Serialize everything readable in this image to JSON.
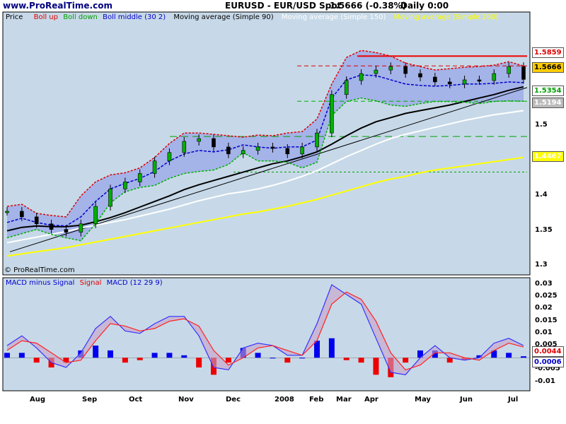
{
  "header": {
    "site": "www.ProRealTime.com",
    "symbol": "EURUSD - EUR/USD Spot",
    "price_change": "1.5666 (-0.38%)",
    "period": "Daily 0:00"
  },
  "watermark": "© ProRealTime.com",
  "colors": {
    "panel_bg": "#c7d9e8",
    "band_fill": "#a0aee8",
    "boll_up": "#dd0000",
    "boll_down": "#00b000",
    "boll_middle": "#0000cc",
    "ma90": "#000000",
    "ma150": "#ffffff",
    "ma200": "#ffff00",
    "resistance": "#ee0000",
    "macd": "#3333ff",
    "signal": "#ff2222"
  },
  "price_legend": {
    "price": "Price",
    "boll_up": "Boll up",
    "boll_down": "Boll down",
    "boll_middle": "Boll middle (30 2)",
    "ma90": "Moving average (Simple 90)",
    "ma150": "Moving average (Simple 150)",
    "ma200": "Moving average (Simple 200)"
  },
  "macd_legend": {
    "histogram": "MACD minus Signal",
    "signal": "Signal",
    "macd": "MACD (12 29 9)"
  },
  "price_badges": {
    "boll_up": "1.5859",
    "last": "1.5666",
    "boll_down": "1.5354",
    "ma150": "1.5194",
    "ma200": "1.4467"
  },
  "macd_badges": {
    "signal": "0.0044",
    "histogram": "0.0006"
  },
  "chart_data": [
    {
      "type": "candlestick",
      "title": "EURUSD - EUR/USD Spot",
      "ylim": [
        1.29,
        1.66
      ],
      "y_ticks": [
        "1.6",
        "1.55",
        "1.5",
        "1.45",
        "1.4",
        "1.35",
        "1.3"
      ],
      "x_labels": [
        "Aug",
        "Sep",
        "Oct",
        "Nov",
        "Dec",
        "2008",
        "Feb",
        "Mar",
        "Apr",
        "May",
        "Jun",
        "Jul"
      ],
      "series": [
        {
          "name": "Price",
          "x": [
            0,
            10,
            20,
            30,
            40,
            50,
            60,
            70,
            80,
            90,
            100,
            110,
            120,
            130,
            140,
            150,
            160,
            170,
            180,
            190,
            200,
            210,
            220,
            230,
            240,
            250,
            260,
            270,
            280,
            290,
            300,
            310,
            320,
            330,
            340,
            350
          ],
          "values": [
            1.378,
            1.37,
            1.36,
            1.352,
            1.348,
            1.36,
            1.385,
            1.41,
            1.42,
            1.432,
            1.45,
            1.462,
            1.478,
            1.482,
            1.47,
            1.46,
            1.465,
            1.47,
            1.468,
            1.46,
            1.47,
            1.49,
            1.545,
            1.565,
            1.575,
            1.58,
            1.585,
            1.575,
            1.57,
            1.563,
            1.56,
            1.566,
            1.565,
            1.575,
            1.585,
            1.5666
          ]
        },
        {
          "name": "Boll up",
          "x": [
            0,
            10,
            20,
            30,
            40,
            50,
            60,
            70,
            80,
            90,
            100,
            110,
            120,
            130,
            140,
            150,
            160,
            170,
            180,
            190,
            200,
            210,
            220,
            230,
            240,
            250,
            260,
            270,
            280,
            290,
            300,
            310,
            320,
            330,
            340,
            350
          ],
          "values": [
            1.385,
            1.388,
            1.375,
            1.372,
            1.37,
            1.4,
            1.42,
            1.43,
            1.433,
            1.44,
            1.455,
            1.475,
            1.49,
            1.49,
            1.488,
            1.486,
            1.484,
            1.487,
            1.486,
            1.49,
            1.492,
            1.51,
            1.56,
            1.598,
            1.608,
            1.605,
            1.6,
            1.59,
            1.585,
            1.58,
            1.582,
            1.584,
            1.585,
            1.587,
            1.592,
            1.5859
          ]
        },
        {
          "name": "Boll down",
          "x": [
            0,
            10,
            20,
            30,
            40,
            50,
            60,
            70,
            80,
            90,
            100,
            110,
            120,
            130,
            140,
            150,
            160,
            170,
            180,
            190,
            200,
            210,
            220,
            230,
            240,
            250,
            260,
            270,
            280,
            290,
            300,
            310,
            320,
            330,
            340,
            350
          ],
          "values": [
            1.34,
            1.346,
            1.352,
            1.345,
            1.34,
            1.336,
            1.36,
            1.39,
            1.406,
            1.412,
            1.415,
            1.425,
            1.432,
            1.435,
            1.437,
            1.445,
            1.462,
            1.45,
            1.45,
            1.448,
            1.44,
            1.448,
            1.515,
            1.535,
            1.54,
            1.536,
            1.53,
            1.528,
            1.532,
            1.535,
            1.535,
            1.534,
            1.532,
            1.535,
            1.536,
            1.5354
          ]
        },
        {
          "name": "Boll middle (30 2)",
          "x": [
            0,
            10,
            20,
            30,
            40,
            50,
            60,
            70,
            80,
            90,
            100,
            110,
            120,
            130,
            140,
            150,
            160,
            170,
            180,
            190,
            200,
            210,
            220,
            230,
            240,
            250,
            260,
            270,
            280,
            290,
            300,
            310,
            320,
            330,
            340,
            350
          ],
          "values": [
            1.362,
            1.368,
            1.362,
            1.358,
            1.357,
            1.37,
            1.392,
            1.41,
            1.418,
            1.425,
            1.435,
            1.45,
            1.46,
            1.465,
            1.463,
            1.466,
            1.473,
            1.47,
            1.468,
            1.47,
            1.47,
            1.48,
            1.54,
            1.566,
            1.573,
            1.572,
            1.566,
            1.56,
            1.558,
            1.557,
            1.558,
            1.56,
            1.56,
            1.561,
            1.563,
            1.562
          ]
        },
        {
          "name": "Moving average (Simple 90)",
          "x": [
            0,
            10,
            20,
            30,
            40,
            50,
            60,
            70,
            80,
            90,
            100,
            110,
            120,
            130,
            140,
            150,
            160,
            170,
            180,
            190,
            200,
            210,
            220,
            230,
            240,
            250,
            260,
            270,
            280,
            290,
            300,
            310,
            320,
            330,
            340,
            350
          ],
          "values": [
            1.35,
            1.355,
            1.357,
            1.356,
            1.356,
            1.358,
            1.363,
            1.369,
            1.376,
            1.384,
            1.392,
            1.4,
            1.409,
            1.416,
            1.422,
            1.428,
            1.434,
            1.44,
            1.446,
            1.45,
            1.456,
            1.463,
            1.474,
            1.486,
            1.497,
            1.506,
            1.512,
            1.518,
            1.522,
            1.526,
            1.53,
            1.535,
            1.54,
            1.545,
            1.551,
            1.556
          ]
        },
        {
          "name": "Moving average (Simple 150)",
          "x": [
            0,
            10,
            20,
            30,
            40,
            50,
            60,
            70,
            80,
            90,
            100,
            110,
            120,
            130,
            140,
            150,
            160,
            170,
            180,
            190,
            200,
            210,
            220,
            230,
            240,
            250,
            260,
            270,
            280,
            290,
            300,
            310,
            320,
            330,
            340,
            350
          ],
          "values": [
            1.333,
            1.337,
            1.341,
            1.345,
            1.349,
            1.354,
            1.358,
            1.362,
            1.366,
            1.371,
            1.376,
            1.381,
            1.387,
            1.393,
            1.398,
            1.403,
            1.406,
            1.41,
            1.415,
            1.421,
            1.428,
            1.436,
            1.446,
            1.456,
            1.465,
            1.474,
            1.482,
            1.488,
            1.493,
            1.498,
            1.503,
            1.508,
            1.512,
            1.516,
            1.519,
            1.522
          ]
        },
        {
          "name": "Moving average (Simple 200)",
          "x": [
            0,
            10,
            20,
            30,
            40,
            50,
            60,
            70,
            80,
            90,
            100,
            110,
            120,
            130,
            140,
            150,
            160,
            170,
            180,
            190,
            200,
            210,
            220,
            230,
            240,
            250,
            260,
            270,
            280,
            290,
            300,
            310,
            320,
            330,
            340,
            350
          ],
          "values": [
            1.314,
            1.317,
            1.32,
            1.323,
            1.326,
            1.33,
            1.334,
            1.338,
            1.342,
            1.346,
            1.35,
            1.354,
            1.358,
            1.362,
            1.366,
            1.37,
            1.374,
            1.377,
            1.381,
            1.385,
            1.39,
            1.395,
            1.401,
            1.407,
            1.413,
            1.419,
            1.424,
            1.428,
            1.433,
            1.437,
            1.44,
            1.443,
            1.446,
            1.449,
            1.452,
            1.455
          ]
        }
      ]
    },
    {
      "type": "bar",
      "title": "MACD (12 29 9)",
      "ylim": [
        -0.013,
        0.032
      ],
      "y_ticks": [
        "0.03",
        "0.025",
        "0.02",
        "0.015",
        "0.01",
        "0.005",
        "0",
        "-0.005",
        "-0.01"
      ],
      "series": [
        {
          "name": "MACD (12 29 9)",
          "x": [
            0,
            10,
            20,
            30,
            40,
            50,
            60,
            70,
            80,
            90,
            100,
            110,
            120,
            130,
            140,
            150,
            160,
            170,
            180,
            190,
            200,
            210,
            220,
            230,
            240,
            250,
            260,
            270,
            280,
            290,
            300,
            310,
            320,
            330,
            340,
            350
          ],
          "values": [
            0.005,
            0.009,
            0.004,
            -0.002,
            -0.004,
            0.002,
            0.012,
            0.017,
            0.011,
            0.01,
            0.014,
            0.017,
            0.017,
            0.009,
            -0.004,
            -0.005,
            0.004,
            0.006,
            0.005,
            0.001,
            0.001,
            0.014,
            0.03,
            0.026,
            0.022,
            0.008,
            -0.006,
            -0.007,
            0.0,
            0.005,
            0.0,
            -0.001,
            0.0,
            0.006,
            0.008,
            0.005
          ]
        },
        {
          "name": "Signal",
          "x": [
            0,
            10,
            20,
            30,
            40,
            50,
            60,
            70,
            80,
            90,
            100,
            110,
            120,
            130,
            140,
            150,
            160,
            170,
            180,
            190,
            200,
            210,
            220,
            230,
            240,
            250,
            260,
            270,
            280,
            290,
            300,
            310,
            320,
            330,
            340,
            350
          ],
          "values": [
            0.003,
            0.007,
            0.006,
            0.002,
            -0.002,
            -0.001,
            0.007,
            0.014,
            0.013,
            0.011,
            0.012,
            0.015,
            0.016,
            0.013,
            0.003,
            -0.003,
            0.0,
            0.004,
            0.005,
            0.003,
            0.001,
            0.007,
            0.022,
            0.027,
            0.024,
            0.015,
            0.002,
            -0.005,
            -0.003,
            0.002,
            0.002,
            0.0,
            -0.001,
            0.003,
            0.006,
            0.0044
          ]
        },
        {
          "name": "MACD minus Signal",
          "x": [
            0,
            10,
            20,
            30,
            40,
            50,
            60,
            70,
            80,
            90,
            100,
            110,
            120,
            130,
            140,
            150,
            160,
            170,
            180,
            190,
            200,
            210,
            220,
            230,
            240,
            250,
            260,
            270,
            280,
            290,
            300,
            310,
            320,
            330,
            340,
            350
          ],
          "values": [
            0.002,
            0.002,
            -0.002,
            -0.004,
            -0.002,
            0.003,
            0.005,
            0.003,
            -0.002,
            -0.001,
            0.002,
            0.002,
            0.001,
            -0.004,
            -0.007,
            -0.002,
            0.004,
            0.002,
            0.0,
            -0.002,
            0.0,
            0.007,
            0.008,
            -0.001,
            -0.002,
            -0.007,
            -0.008,
            -0.002,
            0.003,
            0.003,
            -0.002,
            -0.001,
            0.001,
            0.003,
            0.002,
            0.0006
          ]
        }
      ]
    }
  ]
}
